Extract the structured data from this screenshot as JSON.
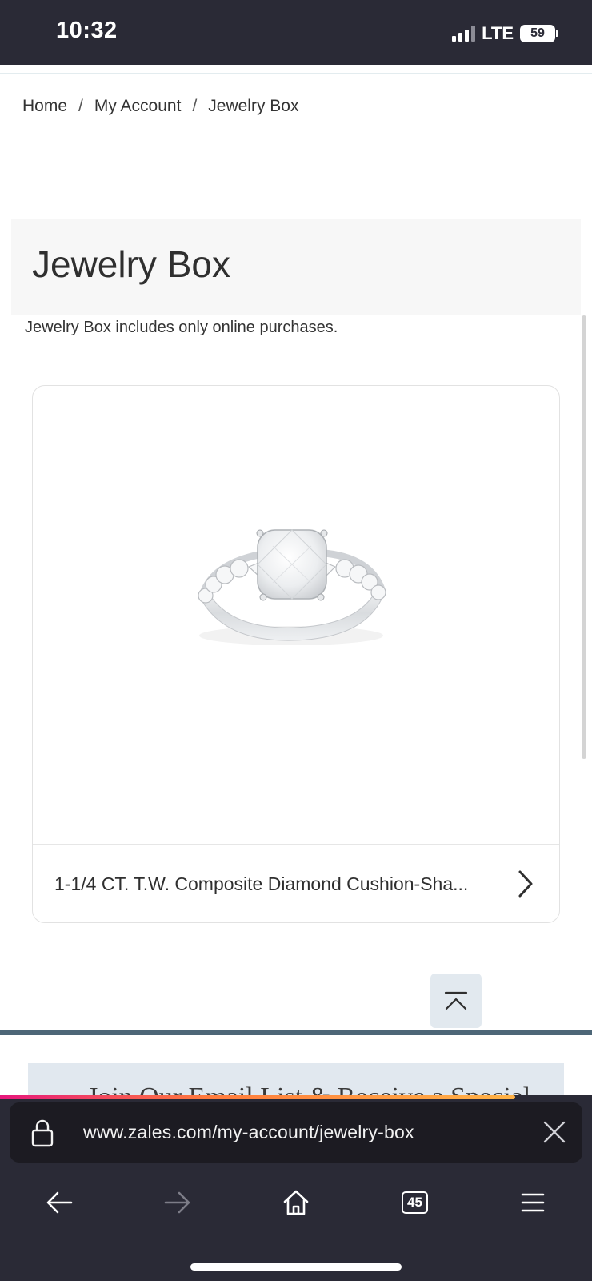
{
  "status_bar": {
    "time": "10:32",
    "network": "LTE",
    "battery": "59"
  },
  "breadcrumb": {
    "items": [
      "Home",
      "My Account",
      "Jewelry Box"
    ],
    "separator": "/"
  },
  "page": {
    "title": "Jewelry Box",
    "subtitle": "Jewelry Box includes only online purchases."
  },
  "product": {
    "name": "1-1/4 CT. T.W. Composite Diamond Cushion-Sha...",
    "image_icon": "ring-image"
  },
  "newsletter": {
    "text": "Join Our Email List & Receive a Special"
  },
  "browser": {
    "url": "www.zales.com/my-account/jewelry-box",
    "tabs_count": "45",
    "page_load_progress": 0.87,
    "accent_gradient": [
      "#e6187c",
      "#ff7a3d",
      "#ffb347"
    ]
  },
  "colors": {
    "status_bar_bg": "#2a2a36",
    "title_banner_bg": "#f7f7f7",
    "footer_rule": "#4d6677",
    "back_to_top_bg": "#e2e9ef"
  }
}
